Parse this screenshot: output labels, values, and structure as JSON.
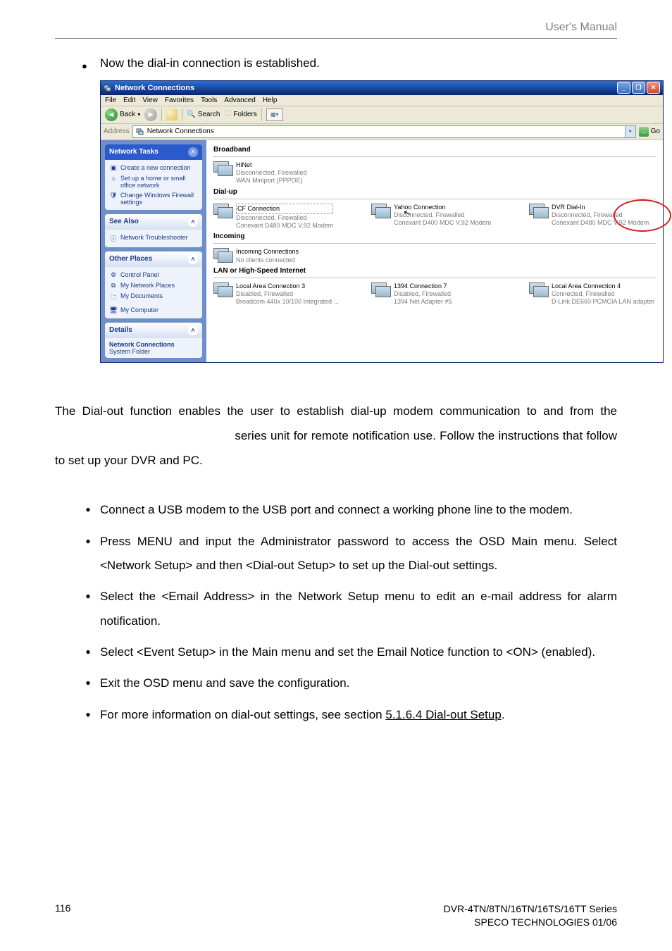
{
  "header": {
    "manual": "User's  Manual"
  },
  "intro_bullet": "Now the dial-in connection is established.",
  "win": {
    "title": "Network Connections",
    "menus": [
      "File",
      "Edit",
      "View",
      "Favorites",
      "Tools",
      "Advanced",
      "Help"
    ],
    "toolbar": {
      "back": "Back",
      "search": "Search",
      "folders": "Folders"
    },
    "address": {
      "label": "Address",
      "value": "Network Connections",
      "go": "Go"
    },
    "side": {
      "tasks_hd": "Network Tasks",
      "tasks": [
        {
          "icon": "▣",
          "label": "Create a new connection"
        },
        {
          "icon": "⌂",
          "label": "Set up a home or small office network"
        },
        {
          "icon": "🛡",
          "label": "Change Windows Firewall settings"
        }
      ],
      "see_hd": "See Also",
      "see": [
        {
          "icon": "ⓘ",
          "label": "Network Troubleshooter"
        }
      ],
      "other_hd": "Other Places",
      "other": [
        {
          "icon": "⚙",
          "label": "Control Panel"
        },
        {
          "icon": "⧉",
          "label": "My Network Places"
        },
        {
          "icon": "🗀",
          "label": "My Documents"
        },
        {
          "icon": "🖥",
          "label": "My Computer"
        }
      ],
      "details_hd": "Details",
      "details_name": "Network Connections",
      "details_type": "System Folder"
    },
    "sections": {
      "broadband": "Broadband",
      "dialup": "Dial-up",
      "incoming": "Incoming",
      "lan": "LAN or High-Speed Internet"
    },
    "conns": {
      "hinet": {
        "name": "HiNet",
        "status": "Disconnected, Firewalled",
        "dev": "WAN Miniport (PPPOE)"
      },
      "cf": {
        "name": "CF Connection",
        "status": "Disconnected, Firewalled",
        "dev": "Conexant D480 MDC V.92 Modem"
      },
      "yahoo": {
        "name": "Yahoo Connection",
        "status": "Disconnected, Firewalled",
        "dev": "Conexant D400 MDC V.92 Modem"
      },
      "dvr": {
        "name": "DVR Dial-In",
        "status": "Disconnected, Firewalled",
        "dev": "Conexant D480 MDC V.92 Modem"
      },
      "inc": {
        "name": "Incoming Connections",
        "status": "No clients connected",
        "dev": ""
      },
      "lac3": {
        "name": "Local Area Connection 3",
        "status": "Disabled, Firewalled",
        "dev": "Broadcom 440x 10/100 Integrated ..."
      },
      "c1394": {
        "name": "1394 Connection 7",
        "status": "Disabled, Firewalled",
        "dev": "1394 Net Adapter #5"
      },
      "lac4": {
        "name": "Local Area Connection 4",
        "status": "Connected, Firewalled",
        "dev": "D-Link DE660 PCMCIA LAN adapter"
      }
    }
  },
  "dialout_heading": "",
  "body_para_1": "The Dial-out function enables the user to establish dial-up modem communication to and from the ",
  "body_para_2": " series unit for remote notification use. Follow the instructions that follow to set up your DVR and PC.",
  "steps_heading": "",
  "steps": [
    "Connect a USB modem to the USB port and connect a working phone line to the modem.",
    "Press MENU and input the Administrator password to access the OSD Main menu. Select <Network Setup> and then <Dial-out Setup> to set up the Dial-out settings.",
    "Select the <Email Address> in the Network Setup menu to edit an e-mail address for alarm notification.",
    "Select <Event Setup> in the Main menu and set the Email Notice function to <ON> (enabled).",
    "Exit the OSD menu and save the configuration."
  ],
  "last_step_pre": "For more information on dial-out settings, see section ",
  "last_step_link": "5.1.6.4 Dial-out Setup",
  "last_step_post": ".",
  "footer": {
    "page": "116",
    "line1": "DVR-4TN/8TN/16TN/16TS/16TT Series",
    "line2": "SPECO TECHNOLOGIES 01/06"
  }
}
